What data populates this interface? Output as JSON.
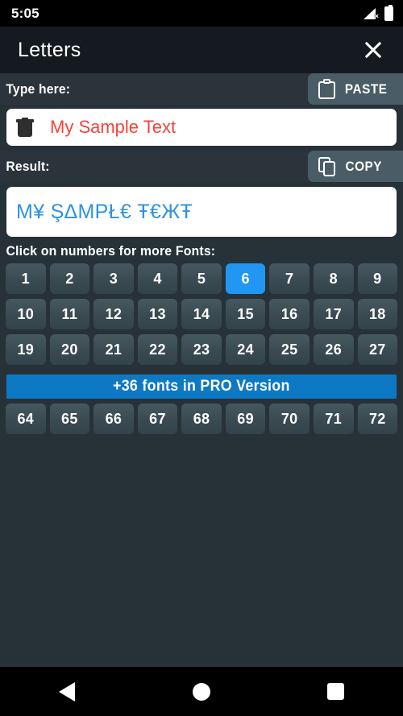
{
  "statusbar": {
    "time": "5:05",
    "signal_icon": "signal-no-sim-icon",
    "battery_icon": "battery-full-icon"
  },
  "titlebar": {
    "title": "Letters",
    "close_icon": "close-icon"
  },
  "input_section": {
    "label": "Type here:",
    "paste_button": "PASTE",
    "paste_icon": "clipboard-icon",
    "clear_icon": "trash-icon",
    "value": "My Sample Text",
    "text_color": "#f4433a"
  },
  "result_section": {
    "label": "Result:",
    "copy_button": "COPY",
    "copy_icon": "copy-icon",
    "value": "M¥ ŞΔMPŁ€ Ŧ€ЖŦ",
    "text_color": "#2e92e0"
  },
  "fonts": {
    "hint": "Click on numbers for more Fonts:",
    "selected": "6",
    "selected_color": "#2196f3",
    "rows": [
      [
        "1",
        "2",
        "3",
        "4",
        "5",
        "6",
        "7",
        "8",
        "9"
      ],
      [
        "10",
        "11",
        "12",
        "13",
        "14",
        "15",
        "16",
        "17",
        "18"
      ],
      [
        "19",
        "20",
        "21",
        "22",
        "23",
        "24",
        "25",
        "26",
        "27"
      ]
    ],
    "pro_banner": "+36 fonts in PRO Version",
    "pro_banner_color": "#0d79c4",
    "pro_rows": [
      [
        "64",
        "65",
        "66",
        "67",
        "68",
        "69",
        "70",
        "71",
        "72"
      ]
    ]
  },
  "navbar": {
    "back_icon": "triangle-back-icon",
    "home_icon": "circle-home-icon",
    "recents_icon": "square-recents-icon"
  }
}
